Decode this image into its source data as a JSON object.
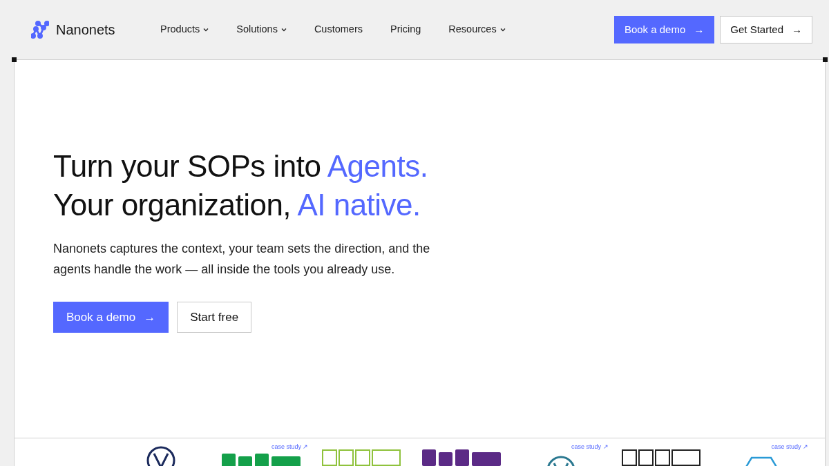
{
  "brand": {
    "name": "Nanonets"
  },
  "nav": [
    {
      "label": "Products",
      "dropdown": true
    },
    {
      "label": "Solutions",
      "dropdown": true
    },
    {
      "label": "Customers",
      "dropdown": false
    },
    {
      "label": "Pricing",
      "dropdown": false
    },
    {
      "label": "Resources",
      "dropdown": true
    }
  ],
  "header_buttons": [
    {
      "label": "Book a demo",
      "icon": "→",
      "kind": "primary"
    },
    {
      "label": "Get Started",
      "icon": "→",
      "kind": "outline"
    }
  ],
  "hero": {
    "headline": [
      [
        {
          "text": "Turn your SOPs into ",
          "accent": false
        },
        {
          "text": "Agents.",
          "accent": true
        }
      ],
      [
        {
          "text": "Your organization, ",
          "accent": false
        },
        {
          "text": "AI native.",
          "accent": true
        }
      ]
    ],
    "description": "Nanonets captures the context, your team sets the direction, and the agents handle the work — all inside the tools you already use.",
    "buttons": [
      {
        "label": "Book a demo",
        "icon": "→",
        "kind": "primary"
      },
      {
        "label": "Start free",
        "kind": "outline"
      }
    ]
  },
  "logos": [
    {
      "kind": "ring",
      "color": "#1b2a5c"
    },
    {
      "kind": "wordmark",
      "color": "#14a04a",
      "case_study": "case study ↗"
    },
    {
      "kind": "thin",
      "color": "#8fc23c"
    },
    {
      "kind": "wordmark",
      "color": "#5b2a86"
    },
    {
      "kind": "ring",
      "color": "#2a7890",
      "case_study": "case study ↗"
    },
    {
      "kind": "thin",
      "color": "#222222"
    },
    {
      "kind": "hexagon",
      "color": "#2a9ad6",
      "case_study": "case study ↗"
    }
  ]
}
